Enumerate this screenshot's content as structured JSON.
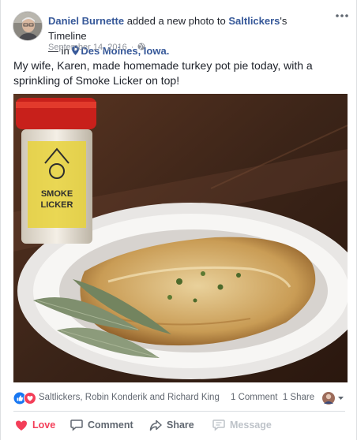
{
  "post": {
    "author": "Daniel Burnette",
    "action_text": " added a new photo to ",
    "page_name": "Saltlickers",
    "timeline_suffix": "'s Timeline",
    "in_text": " — in ",
    "location": "Des Moines, Iowa.",
    "date": "September 14, 2016",
    "separator": "·",
    "privacy_icon": "globe-icon",
    "more_icon": "ellipsis-icon",
    "body_text": "My wife, Karen, made homemade turkey pot pie today, with a sprinkling of Smoke Licker on top!",
    "photo_label_line1": "SMOKE",
    "photo_label_line2": "LICKER"
  },
  "reactions": {
    "icons": [
      "like-icon",
      "love-icon"
    ],
    "names": "Saltlickers, Robin Konderik and Richard King",
    "comments": "1 Comment",
    "shares": "1 Share"
  },
  "actions": {
    "love": "Love",
    "comment": "Comment",
    "share": "Share",
    "message": "Message"
  },
  "colors": {
    "link": "#365899",
    "love": "#f33e58",
    "like": "#1877f2",
    "muted": "#90949c",
    "disabled": "#bec3c9"
  }
}
